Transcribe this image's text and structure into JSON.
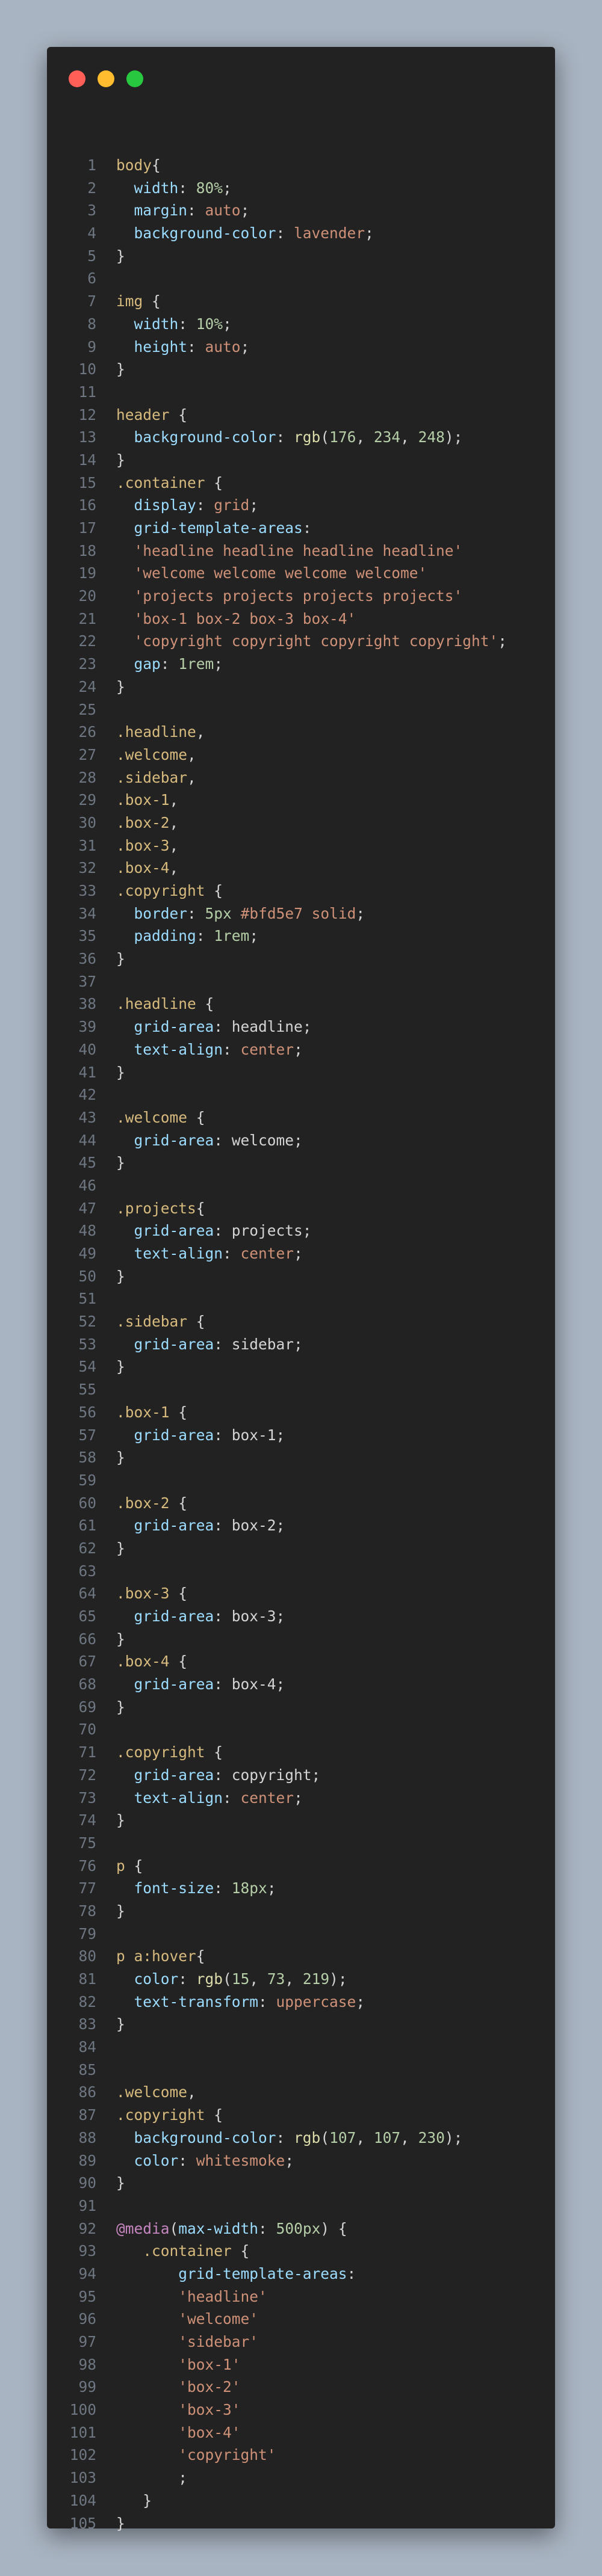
{
  "window": {
    "controls": [
      "close",
      "minimize",
      "maximize"
    ]
  },
  "colors": {
    "selector": "#d7ba7d",
    "property": "#9cdcfe",
    "value": "#ce9178",
    "number": "#b5cea8",
    "function": "#dcdcaa",
    "at_rule": "#c586c0",
    "punctuation": "#d4d4d4",
    "line_number": "#6e7681"
  },
  "code_lines": [
    [
      [
        "sel",
        "body"
      ],
      [
        "p",
        "{"
      ]
    ],
    [
      [
        "p",
        "  "
      ],
      [
        "prop",
        "width"
      ],
      [
        "p",
        ": "
      ],
      [
        "num",
        "80%"
      ],
      [
        "p",
        ";"
      ]
    ],
    [
      [
        "p",
        "  "
      ],
      [
        "prop",
        "margin"
      ],
      [
        "p",
        ": "
      ],
      [
        "val",
        "auto"
      ],
      [
        "p",
        ";"
      ]
    ],
    [
      [
        "p",
        "  "
      ],
      [
        "prop",
        "background-color"
      ],
      [
        "p",
        ": "
      ],
      [
        "val",
        "lavender"
      ],
      [
        "p",
        ";"
      ]
    ],
    [
      [
        "p",
        "}"
      ]
    ],
    [],
    [
      [
        "sel",
        "img"
      ],
      [
        "p",
        " {"
      ]
    ],
    [
      [
        "p",
        "  "
      ],
      [
        "prop",
        "width"
      ],
      [
        "p",
        ": "
      ],
      [
        "num",
        "10%"
      ],
      [
        "p",
        ";"
      ]
    ],
    [
      [
        "p",
        "  "
      ],
      [
        "prop",
        "height"
      ],
      [
        "p",
        ": "
      ],
      [
        "val",
        "auto"
      ],
      [
        "p",
        ";"
      ]
    ],
    [
      [
        "p",
        "}"
      ]
    ],
    [],
    [
      [
        "sel",
        "header"
      ],
      [
        "p",
        " {"
      ]
    ],
    [
      [
        "p",
        "  "
      ],
      [
        "prop",
        "background-color"
      ],
      [
        "p",
        ": "
      ],
      [
        "fn",
        "rgb"
      ],
      [
        "p",
        "("
      ],
      [
        "num",
        "176"
      ],
      [
        "p",
        ", "
      ],
      [
        "num",
        "234"
      ],
      [
        "p",
        ", "
      ],
      [
        "num",
        "248"
      ],
      [
        "p",
        ");"
      ]
    ],
    [
      [
        "p",
        "}"
      ]
    ],
    [
      [
        "sel",
        ".container"
      ],
      [
        "p",
        " {"
      ]
    ],
    [
      [
        "p",
        "  "
      ],
      [
        "prop",
        "display"
      ],
      [
        "p",
        ": "
      ],
      [
        "val",
        "grid"
      ],
      [
        "p",
        ";"
      ]
    ],
    [
      [
        "p",
        "  "
      ],
      [
        "prop",
        "grid-template-areas"
      ],
      [
        "p",
        ":"
      ]
    ],
    [
      [
        "p",
        "  "
      ],
      [
        "val",
        "'headline headline headline headline'"
      ]
    ],
    [
      [
        "p",
        "  "
      ],
      [
        "val",
        "'welcome welcome welcome welcome'"
      ]
    ],
    [
      [
        "p",
        "  "
      ],
      [
        "val",
        "'projects projects projects projects'"
      ]
    ],
    [
      [
        "p",
        "  "
      ],
      [
        "val",
        "'box-1 box-2 box-3 box-4'"
      ]
    ],
    [
      [
        "p",
        "  "
      ],
      [
        "val",
        "'copyright copyright copyright copyright'"
      ],
      [
        "p",
        ";"
      ]
    ],
    [
      [
        "p",
        "  "
      ],
      [
        "prop",
        "gap"
      ],
      [
        "p",
        ": "
      ],
      [
        "num",
        "1rem"
      ],
      [
        "p",
        ";"
      ]
    ],
    [
      [
        "p",
        "}"
      ]
    ],
    [],
    [
      [
        "sel",
        ".headline"
      ],
      [
        "p",
        ","
      ]
    ],
    [
      [
        "sel",
        ".welcome"
      ],
      [
        "p",
        ","
      ]
    ],
    [
      [
        "sel",
        ".sidebar"
      ],
      [
        "p",
        ","
      ]
    ],
    [
      [
        "sel",
        ".box-1"
      ],
      [
        "p",
        ","
      ]
    ],
    [
      [
        "sel",
        ".box-2"
      ],
      [
        "p",
        ","
      ]
    ],
    [
      [
        "sel",
        ".box-3"
      ],
      [
        "p",
        ","
      ]
    ],
    [
      [
        "sel",
        ".box-4"
      ],
      [
        "p",
        ","
      ]
    ],
    [
      [
        "sel",
        ".copyright"
      ],
      [
        "p",
        " {"
      ]
    ],
    [
      [
        "p",
        "  "
      ],
      [
        "prop",
        "border"
      ],
      [
        "p",
        ": "
      ],
      [
        "num",
        "5px"
      ],
      [
        "p",
        " "
      ],
      [
        "val",
        "#bfd5e7"
      ],
      [
        "p",
        " "
      ],
      [
        "val",
        "solid"
      ],
      [
        "p",
        ";"
      ]
    ],
    [
      [
        "p",
        "  "
      ],
      [
        "prop",
        "padding"
      ],
      [
        "p",
        ": "
      ],
      [
        "num",
        "1rem"
      ],
      [
        "p",
        ";"
      ]
    ],
    [
      [
        "p",
        "}"
      ]
    ],
    [],
    [
      [
        "sel",
        ".headline"
      ],
      [
        "p",
        " {"
      ]
    ],
    [
      [
        "p",
        "  "
      ],
      [
        "prop",
        "grid-area"
      ],
      [
        "p",
        ": headline;"
      ]
    ],
    [
      [
        "p",
        "  "
      ],
      [
        "prop",
        "text-align"
      ],
      [
        "p",
        ": "
      ],
      [
        "val",
        "center"
      ],
      [
        "p",
        ";"
      ]
    ],
    [
      [
        "p",
        "}"
      ]
    ],
    [],
    [
      [
        "sel",
        ".welcome"
      ],
      [
        "p",
        " {"
      ]
    ],
    [
      [
        "p",
        "  "
      ],
      [
        "prop",
        "grid-area"
      ],
      [
        "p",
        ": welcome;"
      ]
    ],
    [
      [
        "p",
        "}"
      ]
    ],
    [],
    [
      [
        "sel",
        ".projects"
      ],
      [
        "p",
        "{"
      ]
    ],
    [
      [
        "p",
        "  "
      ],
      [
        "prop",
        "grid-area"
      ],
      [
        "p",
        ": projects;"
      ]
    ],
    [
      [
        "p",
        "  "
      ],
      [
        "prop",
        "text-align"
      ],
      [
        "p",
        ": "
      ],
      [
        "val",
        "center"
      ],
      [
        "p",
        ";"
      ]
    ],
    [
      [
        "p",
        "}"
      ]
    ],
    [],
    [
      [
        "sel",
        ".sidebar"
      ],
      [
        "p",
        " {"
      ]
    ],
    [
      [
        "p",
        "  "
      ],
      [
        "prop",
        "grid-area"
      ],
      [
        "p",
        ": sidebar;"
      ]
    ],
    [
      [
        "p",
        "}"
      ]
    ],
    [],
    [
      [
        "sel",
        ".box-1"
      ],
      [
        "p",
        " {"
      ]
    ],
    [
      [
        "p",
        "  "
      ],
      [
        "prop",
        "grid-area"
      ],
      [
        "p",
        ": box-1;"
      ]
    ],
    [
      [
        "p",
        "}"
      ]
    ],
    [],
    [
      [
        "sel",
        ".box-2"
      ],
      [
        "p",
        " {"
      ]
    ],
    [
      [
        "p",
        "  "
      ],
      [
        "prop",
        "grid-area"
      ],
      [
        "p",
        ": box-2;"
      ]
    ],
    [
      [
        "p",
        "}"
      ]
    ],
    [],
    [
      [
        "sel",
        ".box-3"
      ],
      [
        "p",
        " {"
      ]
    ],
    [
      [
        "p",
        "  "
      ],
      [
        "prop",
        "grid-area"
      ],
      [
        "p",
        ": box-3;"
      ]
    ],
    [
      [
        "p",
        "}"
      ]
    ],
    [
      [
        "sel",
        ".box-4"
      ],
      [
        "p",
        " {"
      ]
    ],
    [
      [
        "p",
        "  "
      ],
      [
        "prop",
        "grid-area"
      ],
      [
        "p",
        ": box-4;"
      ]
    ],
    [
      [
        "p",
        "}"
      ]
    ],
    [],
    [
      [
        "sel",
        ".copyright"
      ],
      [
        "p",
        " {"
      ]
    ],
    [
      [
        "p",
        "  "
      ],
      [
        "prop",
        "grid-area"
      ],
      [
        "p",
        ": copyright;"
      ]
    ],
    [
      [
        "p",
        "  "
      ],
      [
        "prop",
        "text-align"
      ],
      [
        "p",
        ": "
      ],
      [
        "val",
        "center"
      ],
      [
        "p",
        ";"
      ]
    ],
    [
      [
        "p",
        "}"
      ]
    ],
    [],
    [
      [
        "sel",
        "p"
      ],
      [
        "p",
        " {"
      ]
    ],
    [
      [
        "p",
        "  "
      ],
      [
        "prop",
        "font-size"
      ],
      [
        "p",
        ": "
      ],
      [
        "num",
        "18px"
      ],
      [
        "p",
        ";"
      ]
    ],
    [
      [
        "p",
        "}"
      ]
    ],
    [],
    [
      [
        "sel",
        "p a:hover"
      ],
      [
        "p",
        "{"
      ]
    ],
    [
      [
        "p",
        "  "
      ],
      [
        "prop",
        "color"
      ],
      [
        "p",
        ": "
      ],
      [
        "fn",
        "rgb"
      ],
      [
        "p",
        "("
      ],
      [
        "num",
        "15"
      ],
      [
        "p",
        ", "
      ],
      [
        "num",
        "73"
      ],
      [
        "p",
        ", "
      ],
      [
        "num",
        "219"
      ],
      [
        "p",
        ");"
      ]
    ],
    [
      [
        "p",
        "  "
      ],
      [
        "prop",
        "text-transform"
      ],
      [
        "p",
        ": "
      ],
      [
        "val",
        "uppercase"
      ],
      [
        "p",
        ";"
      ]
    ],
    [
      [
        "p",
        "}"
      ]
    ],
    [],
    [],
    [
      [
        "sel",
        ".welcome"
      ],
      [
        "p",
        ","
      ]
    ],
    [
      [
        "sel",
        ".copyright"
      ],
      [
        "p",
        " {"
      ]
    ],
    [
      [
        "p",
        "  "
      ],
      [
        "prop",
        "background-color"
      ],
      [
        "p",
        ": "
      ],
      [
        "fn",
        "rgb"
      ],
      [
        "p",
        "("
      ],
      [
        "num",
        "107"
      ],
      [
        "p",
        ", "
      ],
      [
        "num",
        "107"
      ],
      [
        "p",
        ", "
      ],
      [
        "num",
        "230"
      ],
      [
        "p",
        ");"
      ]
    ],
    [
      [
        "p",
        "  "
      ],
      [
        "prop",
        "color"
      ],
      [
        "p",
        ": "
      ],
      [
        "val",
        "whitesmoke"
      ],
      [
        "p",
        ";"
      ]
    ],
    [
      [
        "p",
        "}"
      ]
    ],
    [],
    [
      [
        "at",
        "@media"
      ],
      [
        "p",
        "("
      ],
      [
        "prop",
        "max-width"
      ],
      [
        "p",
        ": "
      ],
      [
        "num",
        "500px"
      ],
      [
        "p",
        ") {"
      ]
    ],
    [
      [
        "p",
        "   "
      ],
      [
        "sel",
        ".container"
      ],
      [
        "p",
        " {"
      ]
    ],
    [
      [
        "p",
        "       "
      ],
      [
        "prop",
        "grid-template-areas"
      ],
      [
        "p",
        ":"
      ]
    ],
    [
      [
        "p",
        "       "
      ],
      [
        "val",
        "'headline'"
      ]
    ],
    [
      [
        "p",
        "       "
      ],
      [
        "val",
        "'welcome'"
      ]
    ],
    [
      [
        "p",
        "       "
      ],
      [
        "val",
        "'sidebar'"
      ]
    ],
    [
      [
        "p",
        "       "
      ],
      [
        "val",
        "'box-1'"
      ]
    ],
    [
      [
        "p",
        "       "
      ],
      [
        "val",
        "'box-2'"
      ]
    ],
    [
      [
        "p",
        "       "
      ],
      [
        "val",
        "'box-3'"
      ]
    ],
    [
      [
        "p",
        "       "
      ],
      [
        "val",
        "'box-4'"
      ]
    ],
    [
      [
        "p",
        "       "
      ],
      [
        "val",
        "'copyright'"
      ]
    ],
    [
      [
        "p",
        "       ;"
      ]
    ],
    [
      [
        "p",
        "   }"
      ]
    ],
    [
      [
        "p",
        "}"
      ]
    ]
  ]
}
